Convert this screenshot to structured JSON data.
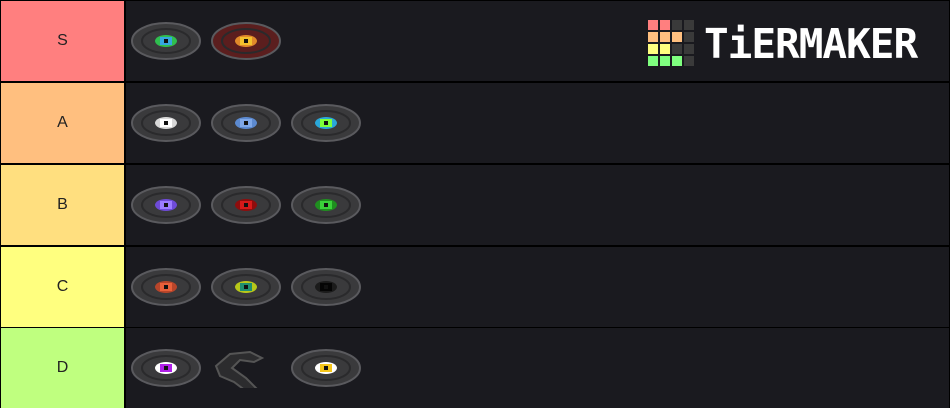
{
  "brand": {
    "name": "TiERMAKER"
  },
  "tiers": [
    {
      "label": "S",
      "color": "#ff7f7f",
      "items": [
        {
          "icon": "music-disc-cyan-icon",
          "center": "#35a7e0",
          "ring": "#2fbf4f",
          "body": "#3a3a3c"
        },
        {
          "icon": "music-disc-pigstep-icon",
          "center": "#f2c12e",
          "ring": "#e08a2a",
          "body": "#5b1e1e"
        }
      ]
    },
    {
      "label": "A",
      "color": "#ffbf7f",
      "items": [
        {
          "icon": "music-disc-white-icon",
          "center": "#ffffff",
          "ring": "#d8d8d8",
          "body": "#3a3a3c"
        },
        {
          "icon": "music-disc-blue-icon",
          "center": "#7fa8e8",
          "ring": "#5c8ad0",
          "body": "#3a3a3c"
        },
        {
          "icon": "music-disc-lime-icon",
          "center": "#7dff3a",
          "ring": "#2aa7d8",
          "body": "#3a3a3c"
        }
      ]
    },
    {
      "label": "B",
      "color": "#ffdf7f",
      "items": [
        {
          "icon": "music-disc-purple-icon",
          "center": "#9b7cff",
          "ring": "#6e4bd8",
          "body": "#3a3a3c"
        },
        {
          "icon": "music-disc-red-icon",
          "center": "#d61a1a",
          "ring": "#8f0d0d",
          "body": "#3a3a3c"
        },
        {
          "icon": "music-disc-green-icon",
          "center": "#3ad13a",
          "ring": "#1f8f1f",
          "body": "#3a3a3c"
        }
      ]
    },
    {
      "label": "C",
      "color": "#ffff7f",
      "items": [
        {
          "icon": "music-disc-orange-icon",
          "center": "#e8603a",
          "ring": "#b8452a",
          "body": "#3a3a3c"
        },
        {
          "icon": "music-disc-teal-icon",
          "center": "#1f8f6f",
          "ring": "#b8c81a",
          "body": "#3a3a3c"
        },
        {
          "icon": "music-disc-black-icon",
          "center": "#050505",
          "ring": "#1b1b1b",
          "body": "#3a3a3c"
        }
      ]
    },
    {
      "label": "D",
      "color": "#bfff7f",
      "items": [
        {
          "icon": "music-disc-magenta-icon",
          "center": "#b020e8",
          "ring": "#ffffff",
          "body": "#3a3a3c"
        },
        {
          "icon": "disc-fragment-icon",
          "center": "#2a2a2c",
          "ring": "#2a2a2c",
          "body": "#3a3a3c"
        },
        {
          "icon": "music-disc-yellow-icon",
          "center": "#f5c61a",
          "ring": "#ffffff",
          "body": "#3a3a3c"
        }
      ]
    }
  ]
}
